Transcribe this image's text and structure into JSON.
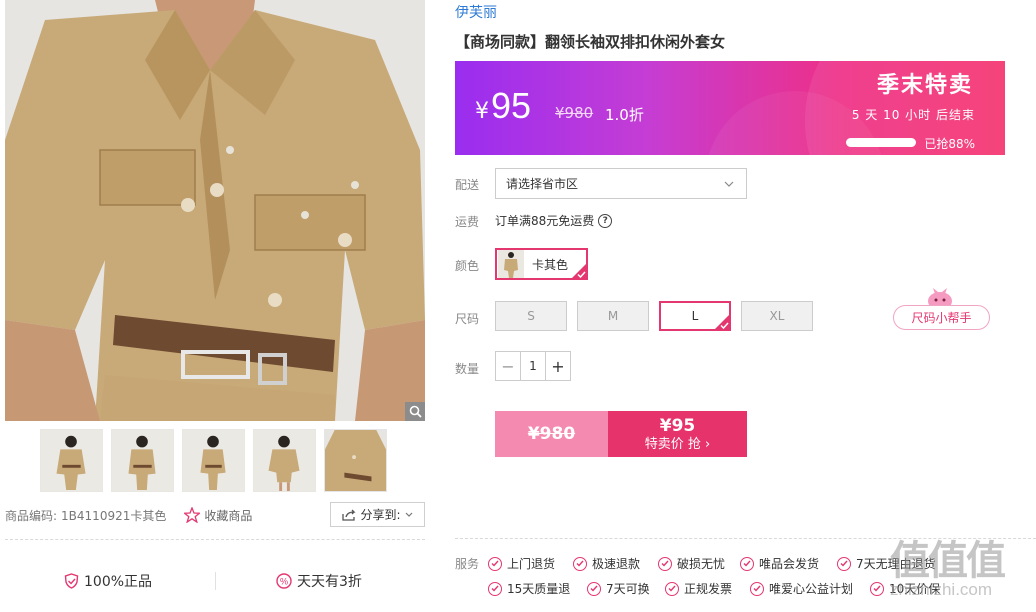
{
  "gallery": {
    "zoom_icon": "magnifier-icon",
    "thumbnails_count_label": ""
  },
  "meta": {
    "code_label": "商品编码:",
    "code_value": "1B4110921卡其色",
    "favorite_label": "收藏商品",
    "share_label": "分享到:"
  },
  "promises": {
    "authentic": "100%正品",
    "daily_discount": "天天有3折"
  },
  "product": {
    "brand": "伊芙丽",
    "title": "【商场同款】翻领长袖双排扣休闲外套女"
  },
  "price": {
    "currency": "¥",
    "now": "95",
    "was": "¥980",
    "discount": "1.0折",
    "sale_title": "季末特卖",
    "countdown": "5 天 10 小时 后结束",
    "sold_label": "已抢88%",
    "sold_fraction": 0.88
  },
  "delivery": {
    "label": "配送",
    "placeholder": "请选择省市区"
  },
  "shipping": {
    "label": "运费",
    "text": "订单满88元免运费"
  },
  "color": {
    "label": "颜色",
    "selected": "卡其色"
  },
  "size": {
    "label": "尺码",
    "options": [
      "S",
      "M",
      "L",
      "XL"
    ],
    "selected": "L",
    "helper": "尺码小帮手"
  },
  "quantity": {
    "label": "数量",
    "value": "1",
    "minus": "−",
    "plus": "+"
  },
  "buy": {
    "orig_price": "¥980",
    "price": "¥95",
    "action": "特卖价 抢 ›"
  },
  "services": {
    "label": "服务",
    "items": [
      "上门退货",
      "极速退款",
      "破损无忧",
      "唯品会发货",
      "7天无理由退货",
      "15天质量退",
      "7天可换",
      "正规发票",
      "唯爱心公益计划",
      "10天价保"
    ]
  },
  "watermark": {
    "glyphs": "值值值",
    "url": "zhizhizhi.com"
  },
  "colors": {
    "accent": "#e4376f",
    "brand_link": "#2e7bd6",
    "banner_start": "#9a2df0",
    "banner_end": "#f5356f"
  }
}
